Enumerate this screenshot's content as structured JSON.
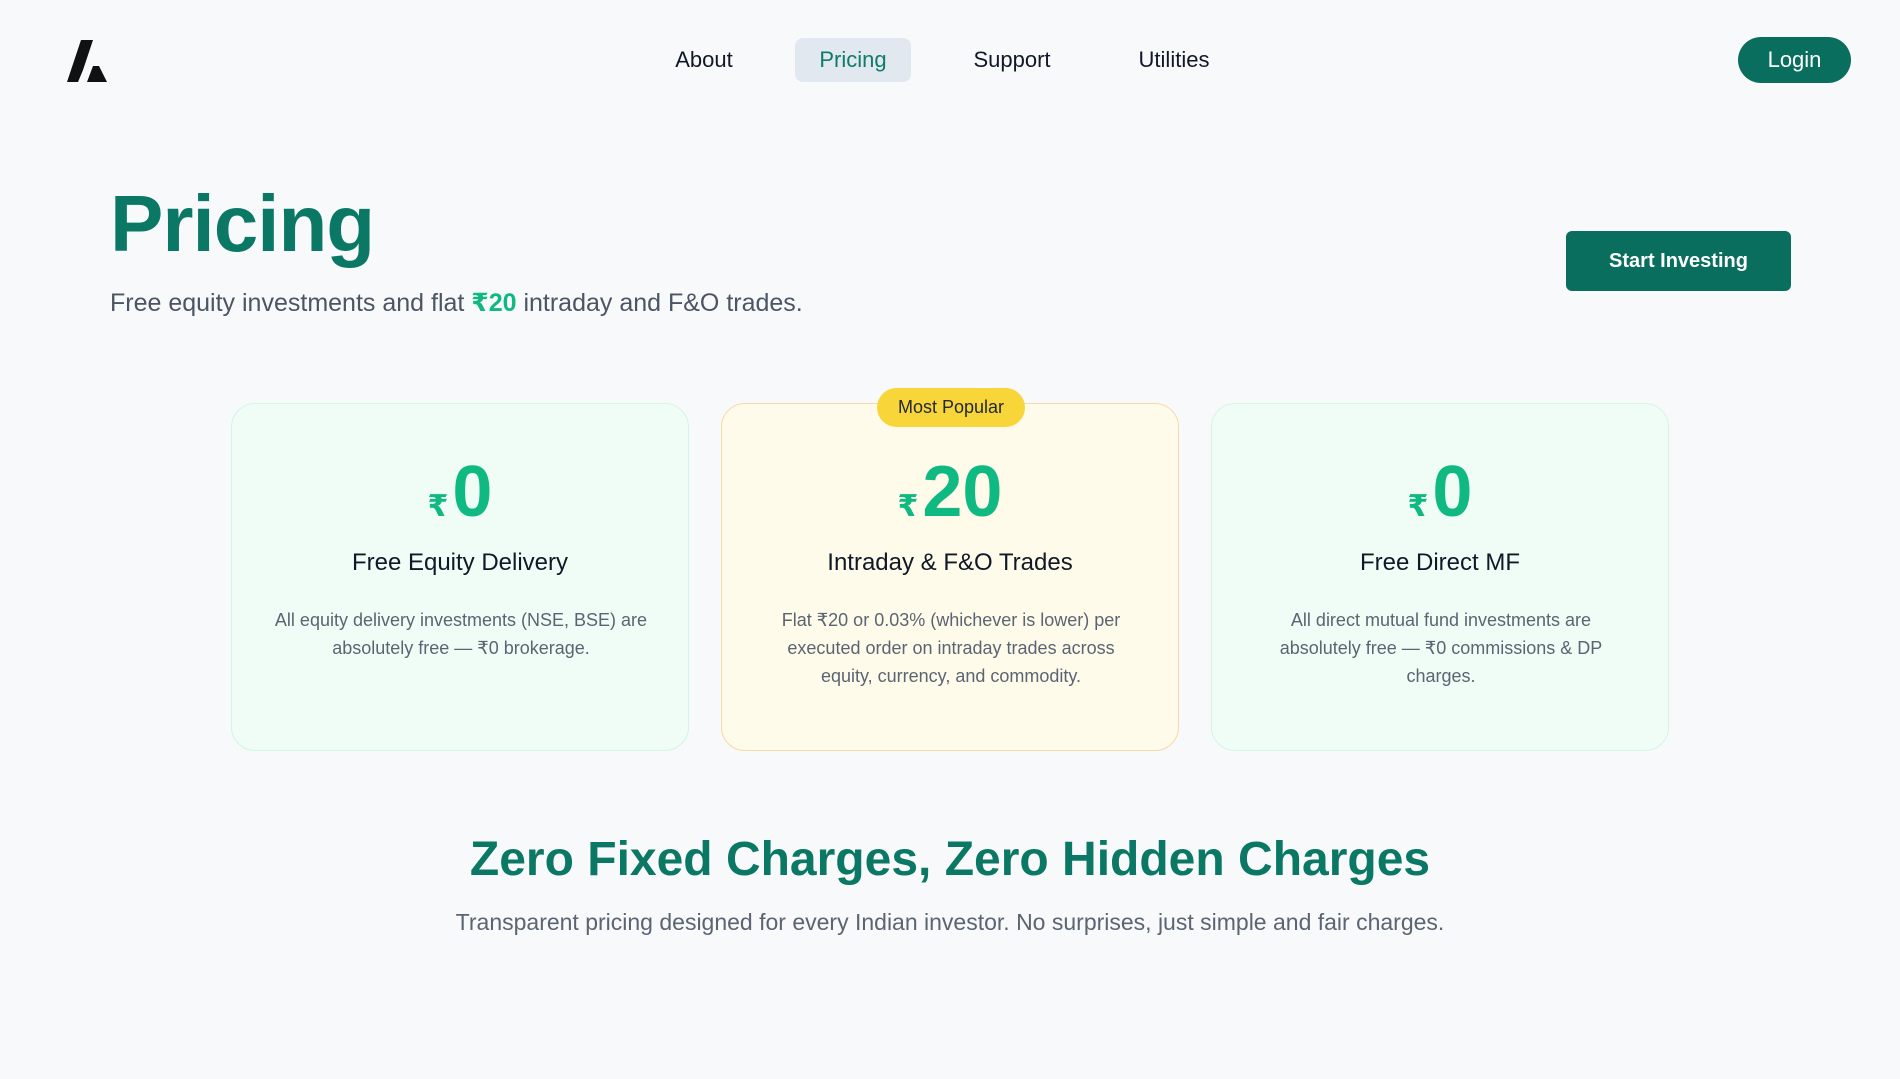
{
  "nav": {
    "items": [
      {
        "label": "About"
      },
      {
        "label": "Pricing",
        "active": true
      },
      {
        "label": "Support"
      },
      {
        "label": "Utilities"
      }
    ],
    "login_label": "Login"
  },
  "hero": {
    "title": "Pricing",
    "subtitle_pre": "Free equity investments and flat ",
    "subtitle_highlight": "₹20",
    "subtitle_post": " intraday and F&O trades.",
    "cta_label": "Start Investing"
  },
  "badge": "Most Popular",
  "cards": [
    {
      "currency": "₹",
      "price": "0",
      "title": "Free Equity Delivery",
      "description": "All equity delivery investments (NSE, BSE) are absolutely free — ₹0 brokerage."
    },
    {
      "currency": "₹",
      "price": "20",
      "title": "Intraday & F&O Trades",
      "description": "Flat ₹20 or 0.03% (whichever is lower) per executed order on intraday trades across equity, currency, and commodity."
    },
    {
      "currency": "₹",
      "price": "0",
      "title": "Free Direct MF",
      "description": "All direct mutual fund investments are absolutely free — ₹0 commissions & DP charges."
    }
  ],
  "section": {
    "title": "Zero Fixed Charges, Zero Hidden Charges",
    "subtitle": "Transparent pricing designed for every Indian investor. No surprises, just simple and fair charges."
  },
  "colors": {
    "brand": "#0a6e5e",
    "accent": "#10b981",
    "badge": "#f8d538"
  },
  "icons": {
    "logo": "brand-logo-icon"
  }
}
